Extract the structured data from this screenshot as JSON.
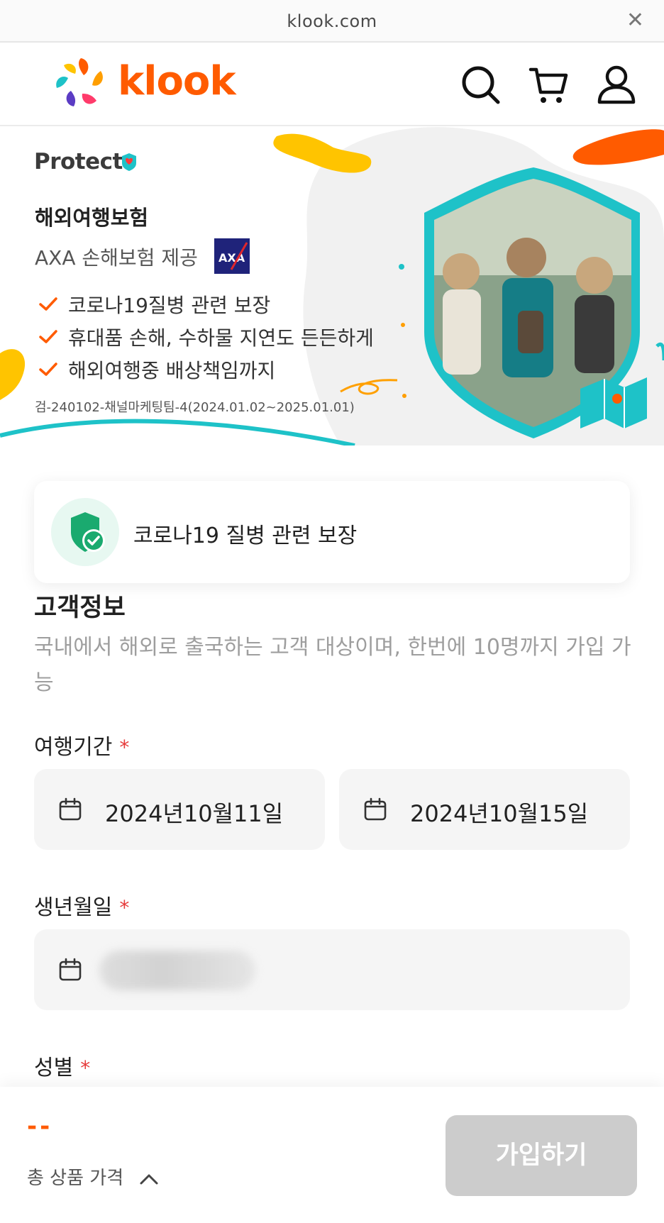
{
  "browser": {
    "url": "klook.com"
  },
  "header": {
    "brand": "klook"
  },
  "banner": {
    "protect": "Protect",
    "title": "해외여행보험",
    "subtitle": "AXA 손해보험 제공",
    "features": [
      "코로나19질병 관련 보장",
      "휴대품 손해, 수하물 지연도 든든하게",
      "해외여행중 배상책임까지"
    ],
    "note": "검-240102-채널마케팅팀-4(2024.01.02~2025.01.01)"
  },
  "coverage": {
    "label": "코로나19 질병 관련 보장"
  },
  "form": {
    "title": "고객정보",
    "description": "국내에서 해외로 출국하는 고객 대상이며, 한번에 10명까지 가입 가능",
    "period": {
      "label": "여행기간",
      "required": "*",
      "start": "2024년10월11일",
      "end": "2024년10월15일"
    },
    "birth": {
      "label": "생년월일",
      "required": "*"
    },
    "gender": {
      "label": "성별",
      "required": "*"
    }
  },
  "footer": {
    "price": "--",
    "total_label": "총 상품 가격",
    "join_label": "가입하기"
  },
  "colors": {
    "brand": "#ff5b00",
    "teal": "#1ec2c8",
    "green": "#1aaa6f",
    "required": "#e63a3a"
  }
}
